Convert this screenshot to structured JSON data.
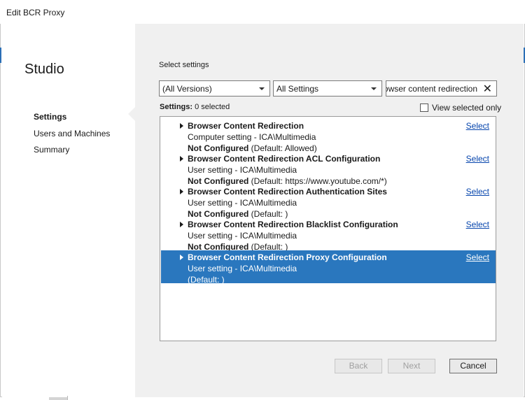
{
  "window": {
    "title": "Edit BCR Proxy"
  },
  "sidebar": {
    "title": "Studio",
    "items": [
      {
        "label": "Settings",
        "active": true
      },
      {
        "label": "Users and Machines",
        "active": false
      },
      {
        "label": "Summary",
        "active": false
      }
    ]
  },
  "main": {
    "section_label": "Select settings",
    "version_filter": "(All Versions)",
    "category_filter": "All Settings",
    "search_value": "browser content redirection",
    "settings_label": "Settings:",
    "selected_count": "0 selected",
    "view_selected_label": "View selected only",
    "select_link": "Select",
    "settings": [
      {
        "name": "Browser Content Redirection",
        "type": "Computer setting - ICA\\Multimedia",
        "state": "Not Configured",
        "default": "(Default: Allowed)"
      },
      {
        "name": "Browser Content Redirection ACL Configuration",
        "type": "User setting - ICA\\Multimedia",
        "state": "Not Configured",
        "default": "(Default: https://www.youtube.com/*)"
      },
      {
        "name": "Browser Content Redirection Authentication Sites",
        "type": "User setting - ICA\\Multimedia",
        "state": "Not Configured",
        "default": "(Default: )"
      },
      {
        "name": "Browser Content Redirection Blacklist Configuration",
        "type": "User setting - ICA\\Multimedia",
        "state": "Not Configured",
        "default": "(Default: )"
      },
      {
        "name": "Browser Content Redirection Proxy Configuration",
        "type": "User setting - ICA\\Multimedia",
        "state": "",
        "default": "(Default: )"
      }
    ]
  },
  "buttons": {
    "back": "Back",
    "next": "Next",
    "cancel": "Cancel"
  },
  "colors": {
    "selection": "#2a77be",
    "link": "#0645ad",
    "panel": "#f0f0f0"
  }
}
